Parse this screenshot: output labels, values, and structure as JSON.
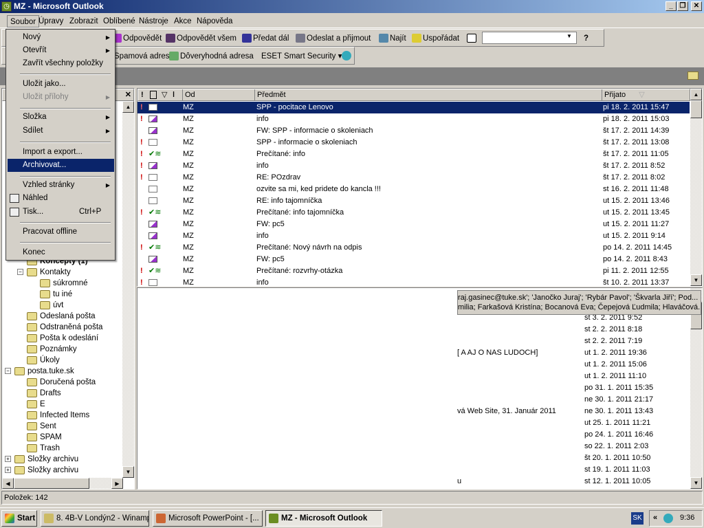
{
  "window": {
    "title": "MZ - Microsoft Outlook",
    "minimize": "_",
    "restore": "❐",
    "close": "✕"
  },
  "menubar": [
    "Soubor",
    "Úpravy",
    "Zobrazit",
    "Oblíbené",
    "Nástroje",
    "Akce",
    "Nápověda"
  ],
  "toolbar1": {
    "reply": "Odpovědět",
    "reply_all": "Odpovědět všem",
    "forward": "Předat dál",
    "send_receive": "Odeslat a přijmout",
    "find": "Najít",
    "organize": "Uspořádat",
    "search_value": "",
    "help": "?"
  },
  "toolbar2": {
    "spam": "Spamová adresa",
    "trusted": "Dôveryhodná adresa",
    "eset": "ESET Smart Security ▾"
  },
  "file_menu": [
    {
      "label": "Nový",
      "submenu": true
    },
    {
      "label": "Otevřít",
      "submenu": true
    },
    {
      "label": "Zavřít všechny položky"
    },
    {
      "sep": true
    },
    {
      "label": "Uložit jako..."
    },
    {
      "label": "Uložit přílohy",
      "submenu": true,
      "disabled": true
    },
    {
      "sep": true
    },
    {
      "label": "Složka",
      "submenu": true
    },
    {
      "label": "Sdílet",
      "submenu": true
    },
    {
      "sep": true
    },
    {
      "label": "Import a export..."
    },
    {
      "label": "Archivovat...",
      "highlighted": true
    },
    {
      "sep": true
    },
    {
      "label": "Vzhled stránky",
      "submenu": true
    },
    {
      "label": "Náhled",
      "icon": "print-preview-icon"
    },
    {
      "label": "Tisk...",
      "shortcut": "Ctrl+P",
      "icon": "printer-icon"
    },
    {
      "sep": true
    },
    {
      "label": "Pracovat offline"
    },
    {
      "sep": true
    },
    {
      "label": "Konec"
    }
  ],
  "folders": [
    {
      "label": "Koncepty (1)",
      "level": 1,
      "bold": true
    },
    {
      "label": "Kontakty",
      "level": 1,
      "expander": "−"
    },
    {
      "label": "súkromné",
      "level": 2
    },
    {
      "label": "tu iné",
      "level": 2
    },
    {
      "label": "úvt",
      "level": 2
    },
    {
      "label": "Odeslaná pošta",
      "level": 1
    },
    {
      "label": "Odstraněná pošta",
      "level": 1
    },
    {
      "label": "Pošta k odeslání",
      "level": 1
    },
    {
      "label": "Poznámky",
      "level": 1
    },
    {
      "label": "Úkoly",
      "level": 1
    },
    {
      "label": "posta.tuke.sk",
      "level": 0,
      "expander": "−"
    },
    {
      "label": "Doručená pošta",
      "level": 1
    },
    {
      "label": "Drafts",
      "level": 1
    },
    {
      "label": "E",
      "level": 1
    },
    {
      "label": "Infected Items",
      "level": 1
    },
    {
      "label": "Sent",
      "level": 1
    },
    {
      "label": "SPAM",
      "level": 1
    },
    {
      "label": "Trash",
      "level": 1
    },
    {
      "label": "Složky archivu",
      "level": 0,
      "expander": "+"
    },
    {
      "label": "Složky archivu",
      "level": 0,
      "expander": "+"
    }
  ],
  "list_headers": {
    "importance": "!",
    "from": "Od",
    "subject": "Předmět",
    "received": "Přijato"
  },
  "messages": [
    {
      "imp": true,
      "icon": "read",
      "from": "MZ",
      "subject": "SPP - pocitace Lenovo",
      "received": "pi 18. 2. 2011 15:47",
      "selected": true
    },
    {
      "imp": true,
      "icon": "replied",
      "from": "MZ",
      "subject": "info",
      "received": "pi 18. 2. 2011 15:03"
    },
    {
      "imp": false,
      "icon": "replied",
      "from": "MZ",
      "subject": "FW: SPP - informacie o skoleniach",
      "received": "št 17. 2. 2011 14:39"
    },
    {
      "imp": true,
      "icon": "read",
      "from": "MZ",
      "subject": "SPP - informacie o skoleniach",
      "received": "št 17. 2. 2011 13:08"
    },
    {
      "imp": true,
      "icon": "receipt",
      "from": "MZ",
      "subject": "Prečítané: info",
      "received": "št 17. 2. 2011 11:05"
    },
    {
      "imp": true,
      "icon": "replied",
      "from": "MZ",
      "subject": "info",
      "received": "št 17. 2. 2011 8:52"
    },
    {
      "imp": true,
      "icon": "read",
      "from": "MZ",
      "subject": "RE: POzdrav",
      "received": "št 17. 2. 2011 8:02"
    },
    {
      "imp": false,
      "icon": "read",
      "from": "MZ",
      "subject": "ozvite sa mi, ked pridete do kancla !!!",
      "received": "st 16. 2. 2011 11:48"
    },
    {
      "imp": false,
      "icon": "read",
      "from": "MZ",
      "subject": "RE: info tajomníčka",
      "received": "ut 15. 2. 2011 13:46"
    },
    {
      "imp": true,
      "icon": "receipt",
      "from": "MZ",
      "subject": "Prečítané: info tajomníčka",
      "received": "ut 15. 2. 2011 13:45"
    },
    {
      "imp": false,
      "icon": "replied",
      "from": "MZ",
      "subject": "FW: pc5",
      "received": "ut 15. 2. 2011 11:27"
    },
    {
      "imp": false,
      "icon": "replied",
      "from": "MZ",
      "subject": "info",
      "received": "ut 15. 2. 2011 9:14"
    },
    {
      "imp": true,
      "icon": "receipt",
      "from": "MZ",
      "subject": "Prečítané: Nový návrh na odpis",
      "received": "po 14. 2. 2011 14:45"
    },
    {
      "imp": false,
      "icon": "replied",
      "from": "MZ",
      "subject": "FW: pc5",
      "received": "po 14. 2. 2011 8:43"
    },
    {
      "imp": true,
      "icon": "receipt",
      "from": "MZ",
      "subject": "Prečítané: rozvrhy-otázka",
      "received": "pi 11. 2. 2011 12:55"
    },
    {
      "imp": true,
      "icon": "read",
      "from": "MZ",
      "subject": "info",
      "received": "št 10. 2. 2011 13:37"
    }
  ],
  "tooltip": [
    "raj.gasinec@tuke.sk'; 'Janočko Juraj'; 'Rybár Pavol'; 'Škvarla Jiří'; Pod...",
    "milia; Farkašová Kristína; Bocanová Eva; Čepejová Ľudmila; Hlaváčová..."
  ],
  "lower_rows": [
    {
      "subject": "",
      "received": "st 3. 2. 2011 9:52"
    },
    {
      "subject": "",
      "received": "st 2. 2. 2011 8:18"
    },
    {
      "subject": "",
      "received": "st 2. 2. 2011 7:19"
    },
    {
      "subject": "[ A AJ O NAS LUDOCH]",
      "received": "ut 1. 2. 2011 19:36"
    },
    {
      "subject": "",
      "received": "ut 1. 2. 2011 15:06"
    },
    {
      "subject": "",
      "received": "ut 1. 2. 2011 11:10"
    },
    {
      "subject": "",
      "received": "po 31. 1. 2011 15:35"
    },
    {
      "subject": "",
      "received": "ne 30. 1. 2011 21:17"
    },
    {
      "subject": "vá Web Site, 31. Január 2011",
      "received": "ne 30. 1. 2011 13:43"
    },
    {
      "subject": "",
      "received": "ut 25. 1. 2011 11:21"
    },
    {
      "subject": "",
      "received": "po 24. 1. 2011 16:46"
    },
    {
      "subject": "",
      "received": "so 22. 1. 2011 2:03"
    },
    {
      "subject": "",
      "received": "št 20. 1. 2011 10:50"
    },
    {
      "subject": "",
      "received": "st 19. 1. 2011 11:03"
    },
    {
      "subject": "u",
      "received": "st 12. 1. 2011 10:05"
    }
  ],
  "status": "Položek: 142",
  "taskbar": {
    "start": "Start",
    "tasks": [
      "8. 4B-V Londýn2 - Winamp",
      "Microsoft PowerPoint - [...",
      "MZ - Microsoft Outlook"
    ],
    "lang": "SK",
    "clock": "9:36",
    "chevron": "«"
  },
  "colors": {
    "selection": "#0a246a",
    "title_start": "#0a246a",
    "title_end": "#a6caf0",
    "importance": "#cc0000"
  }
}
